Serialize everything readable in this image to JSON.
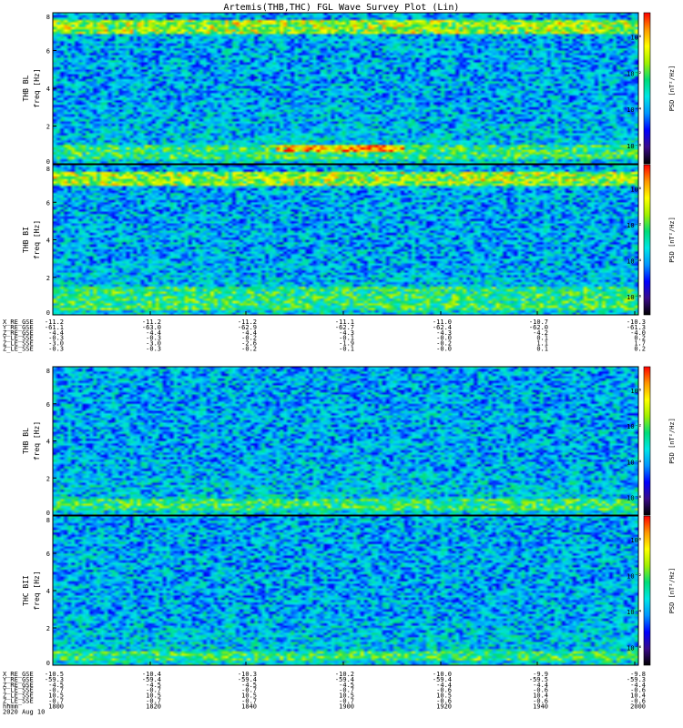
{
  "title": "Artemis(THB,THC) FGL Wave Survey Plot (Lin)",
  "colors": {
    "background": "#ffffff",
    "axis": "#000000",
    "colormap": [
      "#000000",
      "#3a0a8a",
      "#0000ff",
      "#0096ff",
      "#00e6e6",
      "#00dc78",
      "#a0f000",
      "#ffff00",
      "#ff9600",
      "#ff0000"
    ]
  },
  "chart_data": [
    {
      "type": "heatmap",
      "panel": "THB BL",
      "ylabel": [
        "THB BL",
        "freq [Hz]"
      ],
      "ylim": [
        0,
        8
      ],
      "yticks": [
        "0",
        "2",
        "4",
        "6",
        "8"
      ],
      "colorbar": {
        "label": "PSD [nT²/Hz]",
        "ticks": [
          "10⁰",
          "10⁻²",
          "10⁻⁴",
          "10⁻⁶"
        ]
      },
      "features": [
        {
          "kind": "band",
          "freq": [
            6.9,
            7.6
          ],
          "time": [
            0.0,
            1.0
          ],
          "level": "high"
        },
        {
          "kind": "band",
          "freq": [
            0.3,
            1.0
          ],
          "time": [
            0.0,
            1.0
          ],
          "level": "elevated"
        },
        {
          "kind": "band",
          "freq": [
            0.6,
            1.0
          ],
          "time": [
            0.38,
            0.6
          ],
          "level": "high"
        }
      ]
    },
    {
      "type": "heatmap",
      "panel": "THB BI",
      "ylabel": [
        "THB BI",
        "freq [Hz]"
      ],
      "ylim": [
        0,
        8
      ],
      "yticks": [
        "0",
        "2",
        "4",
        "6",
        "8"
      ],
      "colorbar": {
        "label": "PSD [nT²/Hz]",
        "ticks": [
          "10⁰",
          "10⁻²",
          "10⁻⁴",
          "10⁻⁶"
        ]
      },
      "features": [
        {
          "kind": "band",
          "freq": [
            6.9,
            7.6
          ],
          "time": [
            0.0,
            1.0
          ],
          "level": "high"
        },
        {
          "kind": "band",
          "freq": [
            0.3,
            1.5
          ],
          "time": [
            0.0,
            1.0
          ],
          "level": "elevated"
        }
      ]
    },
    {
      "type": "heatmap",
      "panel": "THB BL",
      "ylabel": [
        "THB BL",
        "freq [Hz]"
      ],
      "ylim": [
        0,
        8
      ],
      "yticks": [
        "0",
        "2",
        "4",
        "6",
        "8"
      ],
      "colorbar": {
        "label": "PSD [nT²/Hz]",
        "ticks": [
          "10⁰",
          "10⁻²",
          "10⁻⁴",
          "10⁻⁶"
        ]
      },
      "features": [
        {
          "kind": "band",
          "freq": [
            0.3,
            0.9
          ],
          "time": [
            0.0,
            1.0
          ],
          "level": "elevated"
        }
      ]
    },
    {
      "type": "heatmap",
      "panel": "THC BII",
      "ylabel": [
        "THC BII",
        "freq [Hz]"
      ],
      "ylim": [
        0,
        8
      ],
      "yticks": [
        "0",
        "2",
        "4",
        "6",
        "8"
      ],
      "colorbar": {
        "label": "PSD [nT²/Hz]",
        "ticks": [
          "10⁰",
          "10⁻²",
          "10⁻⁴",
          "10⁻⁶"
        ]
      },
      "features": [
        {
          "kind": "band",
          "freq": [
            0.3,
            0.8
          ],
          "time": [
            0.0,
            1.0
          ],
          "level": "elevated"
        }
      ]
    }
  ],
  "ephemeris": [
    {
      "labels": [
        "X_RE_GSE",
        "Y_RE_GSE",
        "Z_RE_GSE",
        "Y_LE_SSE",
        "Z_LE_SSE",
        "Z_LE_SSE"
      ],
      "columns": [
        [
          "-11.2",
          "-61.1",
          "-4.4",
          "-0.3",
          "-3.0",
          "-0.3"
        ],
        [
          "-11.2",
          "-63.0",
          "-4.4",
          "-0.3",
          "-3.0",
          "-0.3"
        ],
        [
          "-11.2",
          "-62.9",
          "-4.4",
          "-0.2",
          "-2.6",
          "-0.2"
        ],
        [
          "-11.1",
          "-62.7",
          "-4.3",
          "-0.1",
          "-1.9",
          "-0.1"
        ],
        [
          "-11.0",
          "-62.4",
          "-4.3",
          "-0.0",
          "-0.2",
          "-0.0"
        ],
        [
          "-10.7",
          "-62.0",
          "-4.2",
          "0.1",
          "1.1",
          "0.1"
        ],
        [
          "-10.3",
          "-61.3",
          "-4.0",
          "0.2",
          "1.7",
          "0.2"
        ]
      ]
    },
    {
      "labels": [
        "X_RE_GSE",
        "Y_RE_GSE",
        "Z_RE_GSE",
        "Y_LE_SSE",
        "Z_LE_SSE",
        "Z_LE_SSE",
        "hhmm",
        "2020 Aug 10"
      ],
      "columns": [
        [
          "-10.5",
          "-59.3",
          "-4.5",
          "-0.7",
          "10.5",
          "-0.7",
          "1800",
          ""
        ],
        [
          "-10.4",
          "-59.4",
          "-4.5",
          "-0.7",
          "10.5",
          "-0.7",
          "1820",
          ""
        ],
        [
          "-10.3",
          "-59.4",
          "-4.5",
          "-0.7",
          "10.5",
          "-0.7",
          "1840",
          ""
        ],
        [
          "-10.2",
          "-59.4",
          "-4.5",
          "-0.7",
          "10.5",
          "-0.7",
          "1900",
          ""
        ],
        [
          "-10.0",
          "-59.4",
          "-4.4",
          "-0.6",
          "10.5",
          "-0.6",
          "1920",
          ""
        ],
        [
          "-9.9",
          "-59.5",
          "-4.4",
          "-0.6",
          "10.4",
          "-0.6",
          "1940",
          ""
        ],
        [
          "-9.8",
          "-59.3",
          "-4.4",
          "-0.6",
          "10.4",
          "-0.6",
          "2000",
          ""
        ]
      ]
    }
  ]
}
